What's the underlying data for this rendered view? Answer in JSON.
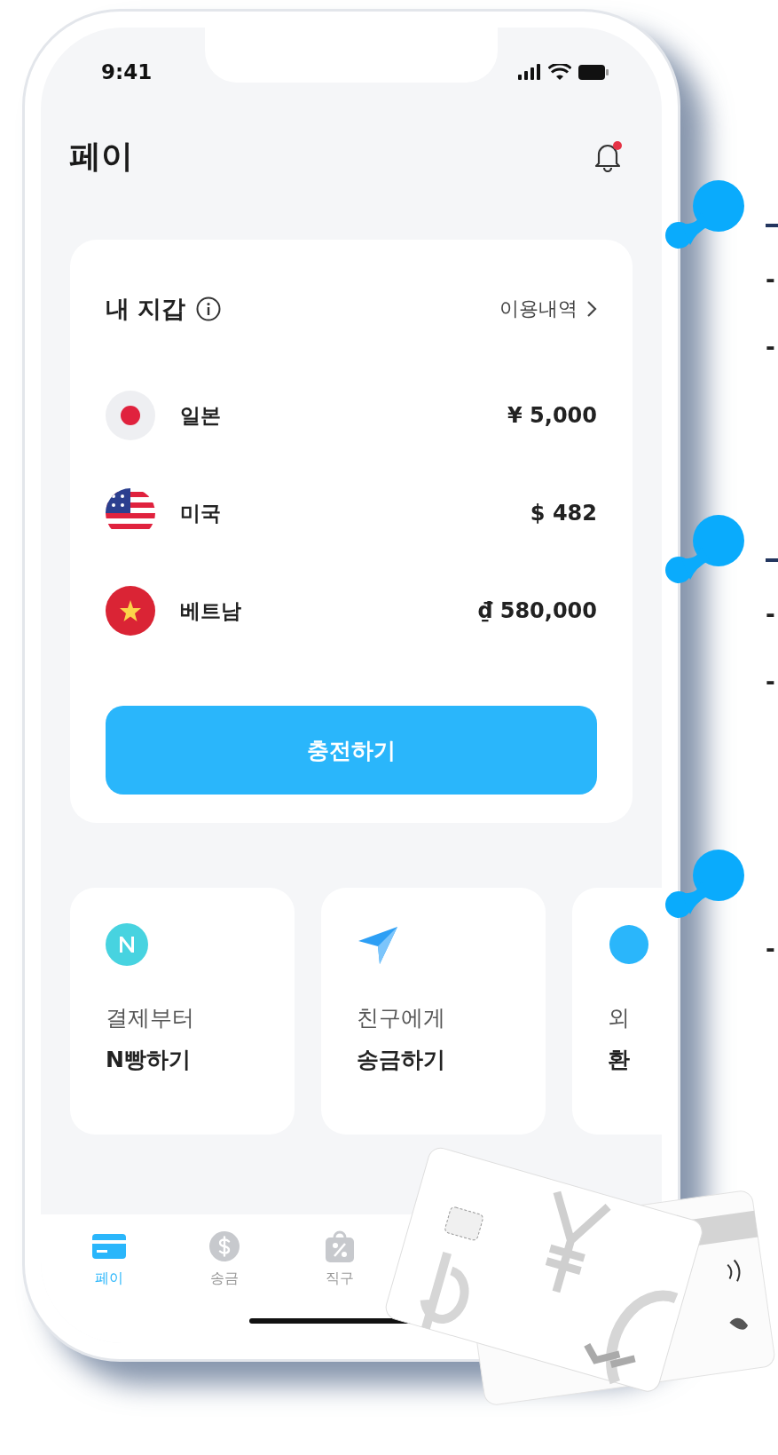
{
  "status_bar": {
    "time": "9:41"
  },
  "header": {
    "title": "페이",
    "notification_dot": true
  },
  "wallet": {
    "title": "내 지갑",
    "history_link": "이용내역",
    "balances": [
      {
        "country": "일본",
        "amount": "¥ 5,000"
      },
      {
        "country": "미국",
        "amount": "$ 482"
      },
      {
        "country": "베트남",
        "amount": "₫ 580,000"
      }
    ],
    "charge_button": "충전하기"
  },
  "features": [
    {
      "line_1": "결제부터",
      "line_2": "N빵하기"
    },
    {
      "line_1": "친구에게",
      "line_2": "송금하기"
    },
    {
      "line_1": "외",
      "line_2": "환"
    }
  ],
  "tab_bar": [
    {
      "label": "페이",
      "selected": true
    },
    {
      "label": "송금",
      "selected": false
    },
    {
      "label": "직구",
      "selected": false
    }
  ],
  "annotations": [
    {
      "underlined": true,
      "bullets": [
        "-",
        "-"
      ]
    },
    {
      "underlined": true,
      "bullets": [
        "-",
        "-"
      ]
    },
    {
      "underlined": false,
      "bullets": [
        "-"
      ]
    }
  ]
}
